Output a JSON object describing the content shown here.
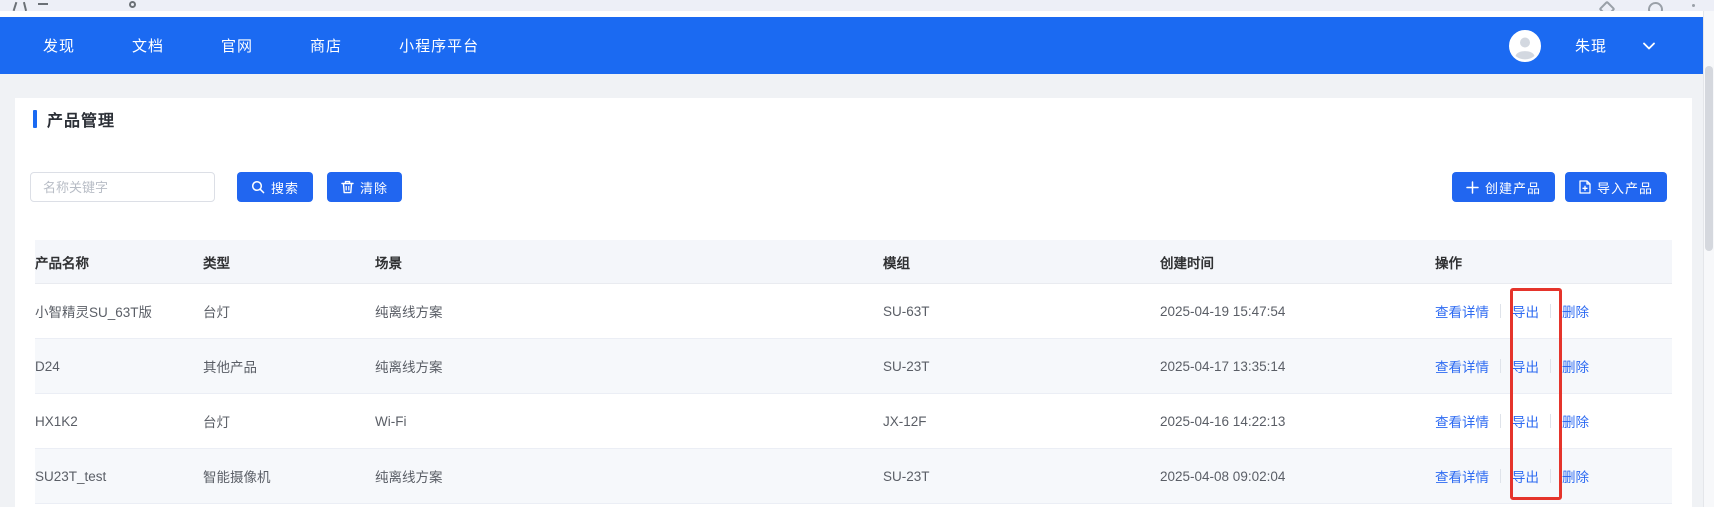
{
  "navbar": {
    "items": [
      {
        "label": "发现"
      },
      {
        "label": "文档"
      },
      {
        "label": "官网"
      },
      {
        "label": "商店"
      },
      {
        "label": "小程序平台"
      }
    ],
    "user_name": "朱琨"
  },
  "page": {
    "title": "产品管理"
  },
  "filters": {
    "search_placeholder": "名称关键字",
    "search_label": "搜索",
    "clear_label": "清除",
    "create_label": "创建产品",
    "import_label": "导入产品"
  },
  "table": {
    "columns": [
      "产品名称",
      "类型",
      "场景",
      "模组",
      "创建时间",
      "操作"
    ],
    "rows": [
      {
        "name": "小智精灵SU_63T版",
        "type": "台灯",
        "scene": "纯离线方案",
        "module": "SU-63T",
        "created": "2025-04-19 15:47:54",
        "actions": [
          "查看详情",
          "导出",
          "删除"
        ]
      },
      {
        "name": "D24",
        "type": "其他产品",
        "scene": "纯离线方案",
        "module": "SU-23T",
        "created": "2025-04-17 13:35:14",
        "actions": [
          "查看详情",
          "导出",
          "删除"
        ]
      },
      {
        "name": "HX1K2",
        "type": "台灯",
        "scene": "Wi-Fi",
        "module": "JX-12F",
        "created": "2025-04-16 14:22:13",
        "actions": [
          "查看详情",
          "导出",
          "删除"
        ]
      },
      {
        "name": "SU23T_test",
        "type": "智能摄像机",
        "scene": "纯离线方案",
        "module": "SU-23T",
        "created": "2025-04-08 09:02:04",
        "actions": [
          "查看详情",
          "导出",
          "删除"
        ]
      }
    ]
  },
  "icons": {
    "search": "magnifier",
    "clear": "trash-can",
    "create": "plus",
    "import": "document",
    "user": "person-avatar",
    "user_menu": "chevron-down"
  },
  "colors": {
    "navbar": "#1b6af2",
    "button": "#2166f0",
    "link": "#2e6bf2",
    "annotation": "#e5342b",
    "page_background": "#f0f2f5",
    "table_header_background": "#f4f6fa"
  }
}
